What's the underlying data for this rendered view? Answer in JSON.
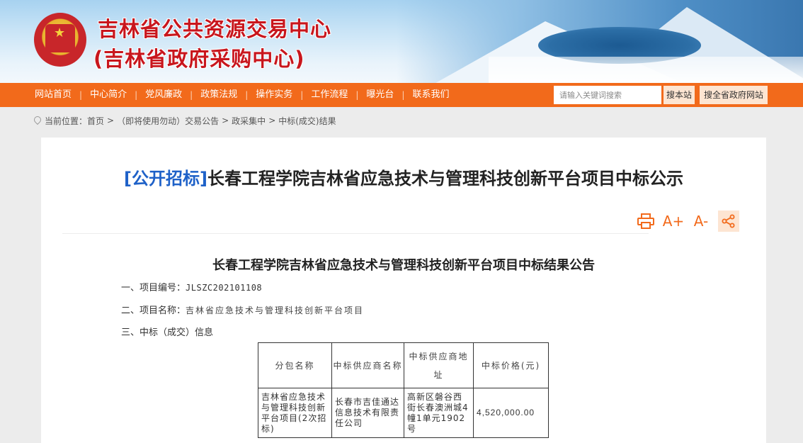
{
  "header": {
    "title": "吉林省公共资源交易中心",
    "subtitle": "(吉林省政府采购中心)"
  },
  "nav": {
    "items": [
      {
        "label": "网站首页"
      },
      {
        "label": "中心简介"
      },
      {
        "label": "党风廉政"
      },
      {
        "label": "政策法规"
      },
      {
        "label": "操作实务"
      },
      {
        "label": "工作流程"
      },
      {
        "label": "曝光台"
      },
      {
        "label": "联系我们"
      }
    ],
    "search_placeholder": "请输入关键词搜索",
    "search_button": "搜本站",
    "search_all_button": "搜全省政府网站"
  },
  "breadcrumb": {
    "prefix": "当前位置：",
    "items": [
      "首页",
      "（即将使用勿动）交易公告",
      "政采集中",
      "中标(成交)结果"
    ],
    "separator": ">"
  },
  "article": {
    "tag": "[公开招标]",
    "title": "长春工程学院吉林省应急技术与管理科技创新平台项目中标公示",
    "tools": {
      "print": "print-icon",
      "font_up": "A+",
      "font_down": "A-",
      "share": "share-icon"
    },
    "doc_title": "长春工程学院吉林省应急技术与管理科技创新平台项目中标结果公告",
    "project_no_label": "一、项目编号：",
    "project_no": "JLSZC202101108",
    "project_name_label": "二、项目名称：",
    "project_name": "吉林省应急技术与管理科技创新平台项目",
    "section3": "三、中标（成交）信息",
    "table": {
      "headers": [
        "分包名称",
        "中标供应商名称",
        "中标供应商地址",
        "中标价格(元)"
      ],
      "rows": [
        [
          "吉林省应急技术与管理科技创新平台项目(2次招标)",
          "长春市吉佳通达信息技术有限责任公司",
          "高新区磐谷西街长春澳洲城4幢1单元1902号",
          "4,520,000.00"
        ]
      ]
    }
  },
  "colors": {
    "nav_bg": "#f26a1b",
    "brand_red": "#c8161d",
    "tag_blue": "#1e61c8"
  }
}
